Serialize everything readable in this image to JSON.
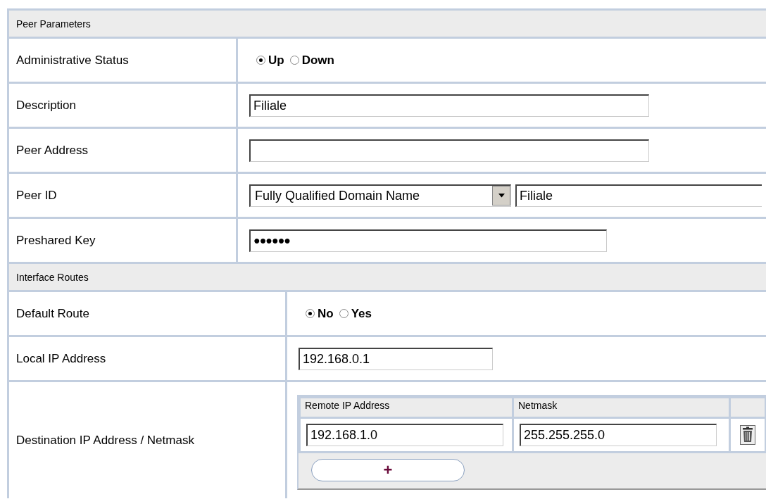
{
  "sections": [
    {
      "title": "Peer Parameters",
      "rows": [
        {
          "kind": "radio",
          "label": "Administrative Status",
          "options": [
            {
              "label": "Up",
              "selected": true
            },
            {
              "label": "Down",
              "selected": false
            }
          ]
        },
        {
          "kind": "text",
          "label": "Description",
          "value": "Filiale"
        },
        {
          "kind": "text",
          "label": "Peer Address",
          "value": ""
        },
        {
          "kind": "select_text",
          "label": "Peer ID",
          "select": "Fully Qualified Domain Name",
          "value": "Filiale"
        },
        {
          "kind": "password",
          "label": "Preshared Key",
          "value": "●●●●●●"
        }
      ]
    },
    {
      "title": "Interface Routes",
      "rows": [
        {
          "kind": "radio",
          "label": "Default Route",
          "options": [
            {
              "label": "No",
              "selected": true
            },
            {
              "label": "Yes",
              "selected": false
            }
          ]
        },
        {
          "kind": "short_text",
          "label": "Local IP Address",
          "value": "192.168.0.1"
        },
        {
          "kind": "route_table",
          "label": "Destination IP Address / Netmask",
          "columns": [
            "Remote IP Address",
            "Netmask"
          ],
          "rows": [
            {
              "remote": "192.168.1.0",
              "netmask": "255.255.255.0"
            }
          ],
          "add_button": "+"
        }
      ]
    }
  ]
}
